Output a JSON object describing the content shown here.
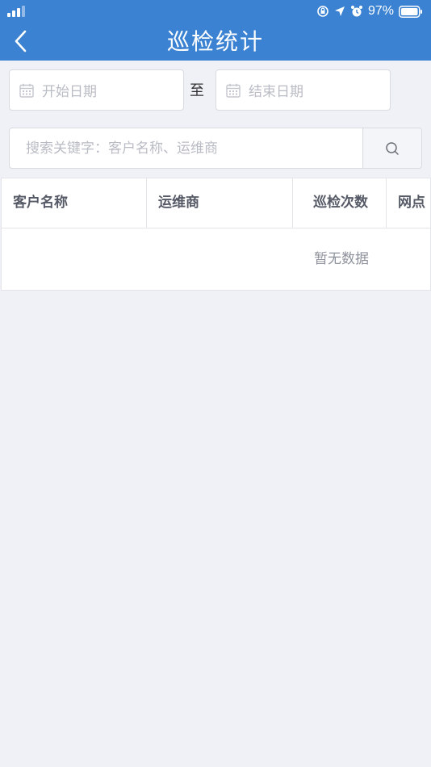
{
  "status_bar": {
    "battery_percent": "97%",
    "icons": [
      "signal-icon",
      "orientation-lock-icon",
      "location-arrow-icon",
      "alarm-icon",
      "battery-icon"
    ]
  },
  "nav": {
    "title": "巡检统计",
    "back_icon": "chevron-left-icon"
  },
  "filters": {
    "start_date_placeholder": "开始日期",
    "separator": "至",
    "end_date_placeholder": "结束日期",
    "calendar_icon": "calendar-icon"
  },
  "search": {
    "placeholder": "搜索关键字：客户名称、运维商",
    "value": "",
    "icon": "search-icon"
  },
  "table": {
    "columns": [
      "客户名称",
      "运维商",
      "巡检次数",
      "网点"
    ],
    "rows": [],
    "empty_text": "暂无数据"
  },
  "colors": {
    "header_bg": "#3b82d2",
    "page_bg": "#f0f1f6"
  }
}
